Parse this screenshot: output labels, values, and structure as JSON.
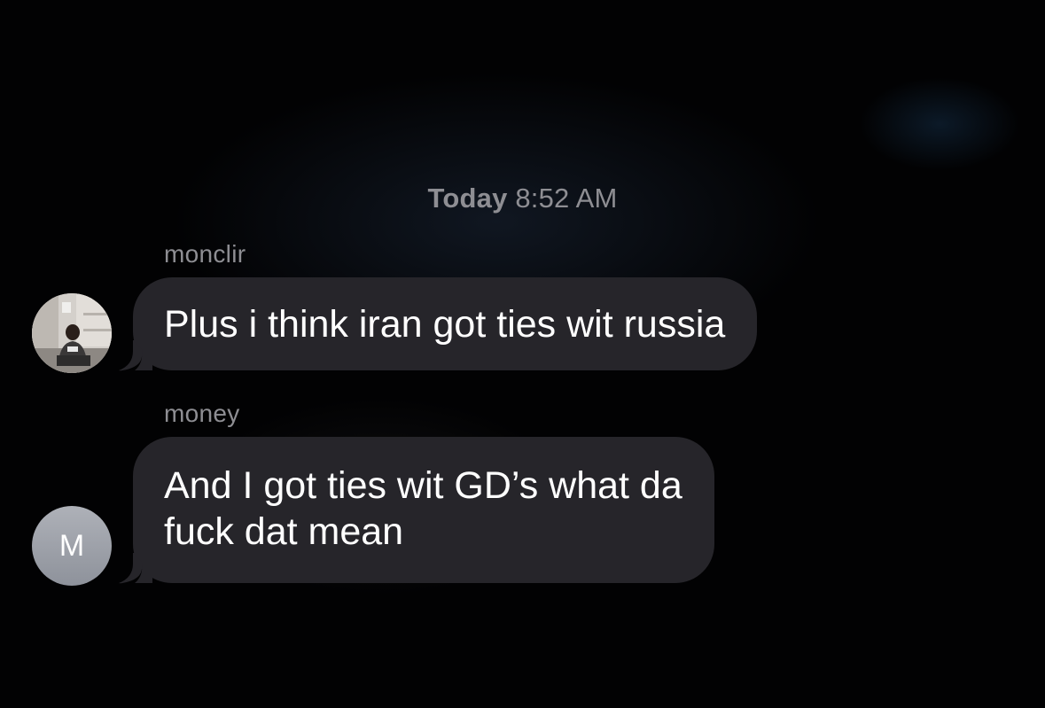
{
  "thread": {
    "timestamp_day": "Today",
    "timestamp_time": "8:52 AM"
  },
  "messages": [
    {
      "sender": "monclir",
      "text": "Plus i think iran got ties wit russia",
      "avatar": "photo"
    },
    {
      "sender": "money",
      "text_line1": "And I got ties wit GD’s what da",
      "text_line2": "fuck dat mean",
      "avatar_initial": "M"
    }
  ],
  "colors": {
    "background": "#020203",
    "bubble": "#26252a",
    "meta_text": "#8e8e93",
    "message_text": "#ffffff"
  }
}
